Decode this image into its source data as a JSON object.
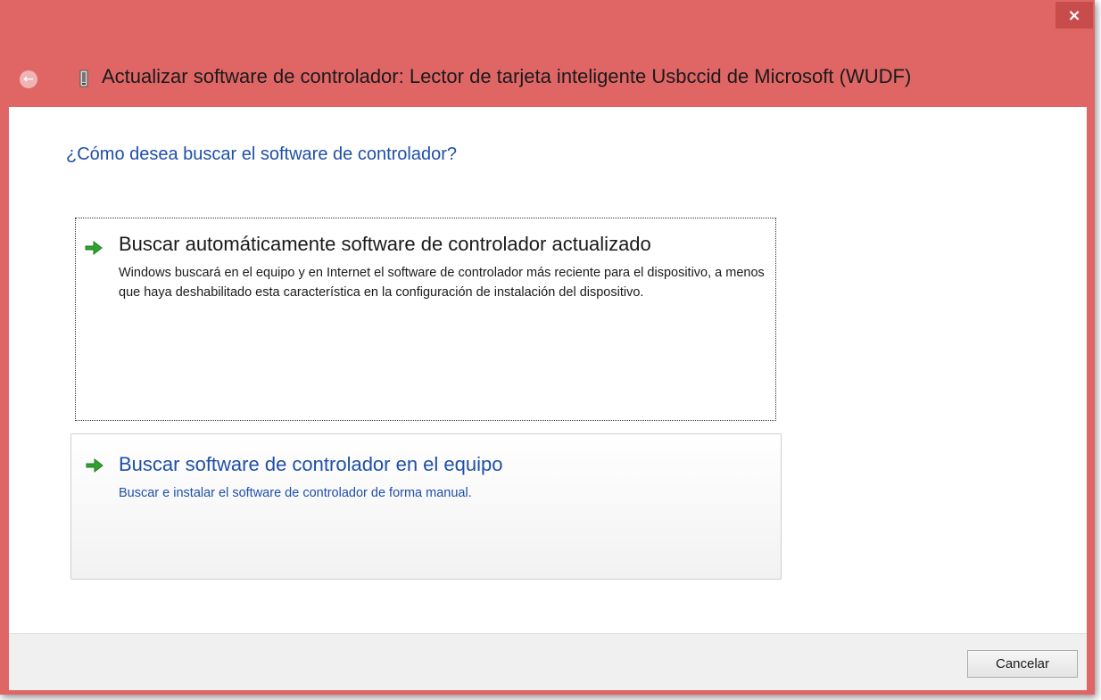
{
  "window": {
    "title": "Actualizar software de controlador: Lector de tarjeta inteligente Usbccid de Microsoft (WUDF)",
    "close_glyph": "×",
    "back_glyph": "←",
    "frame_color": "#e06666",
    "accent_color": "#1f4fa8"
  },
  "main": {
    "question": "¿Cómo desea buscar el software de controlador?",
    "options": [
      {
        "title": "Buscar automáticamente software de controlador actualizado",
        "description": "Windows buscará en el equipo y en Internet el software de controlador más reciente para el dispositivo, a menos que haya deshabilitado esta característica en la configuración de instalación del dispositivo.",
        "icon": "green-arrow-icon"
      },
      {
        "title": "Buscar software de controlador en el equipo",
        "description": "Buscar e instalar el software de controlador de forma manual.",
        "icon": "green-arrow-icon"
      }
    ]
  },
  "footer": {
    "cancel_label": "Cancelar"
  }
}
